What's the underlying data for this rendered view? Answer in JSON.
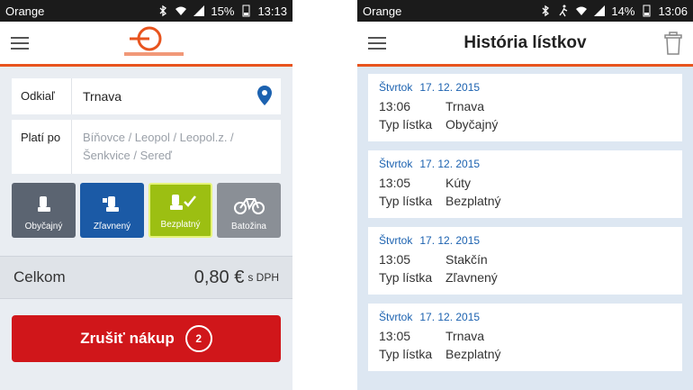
{
  "left": {
    "status": {
      "carrier": "Orange",
      "battery": "15%",
      "time": "13:13"
    },
    "appbar": {
      "logo_text": "ŽELEZNIČNÁ SPOLOČNOSŤ SLOVENSKO"
    },
    "from": {
      "label": "Odkiaľ",
      "value": "Trnava"
    },
    "valid": {
      "label": "Platí po",
      "placeholder": "Bíňovce / Leopol / Leopol.z. / Šenkvice / Sereď"
    },
    "ticket_types": [
      {
        "label": "Obyčajný"
      },
      {
        "label": "Zľavnený"
      },
      {
        "label": "Bezplatný"
      },
      {
        "label": "Batožina"
      }
    ],
    "total": {
      "label": "Celkom",
      "price": "0,80 €",
      "vat": "s DPH"
    },
    "cancel": {
      "label": "Zrušiť nákup",
      "count": "2"
    }
  },
  "right": {
    "status": {
      "carrier": "Orange",
      "battery": "14%",
      "time": "13:06"
    },
    "title": "História lístkov",
    "type_key": "Typ lístka",
    "tickets": [
      {
        "day": "Štvrtok",
        "date": "17. 12. 2015",
        "time": "13:06",
        "station": "Trnava",
        "type": "Obyčajný"
      },
      {
        "day": "Štvrtok",
        "date": "17. 12. 2015",
        "time": "13:05",
        "station": "Kúty",
        "type": "Bezplatný"
      },
      {
        "day": "Štvrtok",
        "date": "17. 12. 2015",
        "time": "13:05",
        "station": "Stakčín",
        "type": "Zľavnený"
      },
      {
        "day": "Štvrtok",
        "date": "17. 12. 2015",
        "time": "13:05",
        "station": "Trnava",
        "type": "Bezplatný"
      }
    ]
  },
  "colors": {
    "accent": "#e8541e",
    "cancel": "#d0161a",
    "free": "#9cbf12",
    "reduced": "#1b5aa6",
    "date": "#1c62b0"
  }
}
